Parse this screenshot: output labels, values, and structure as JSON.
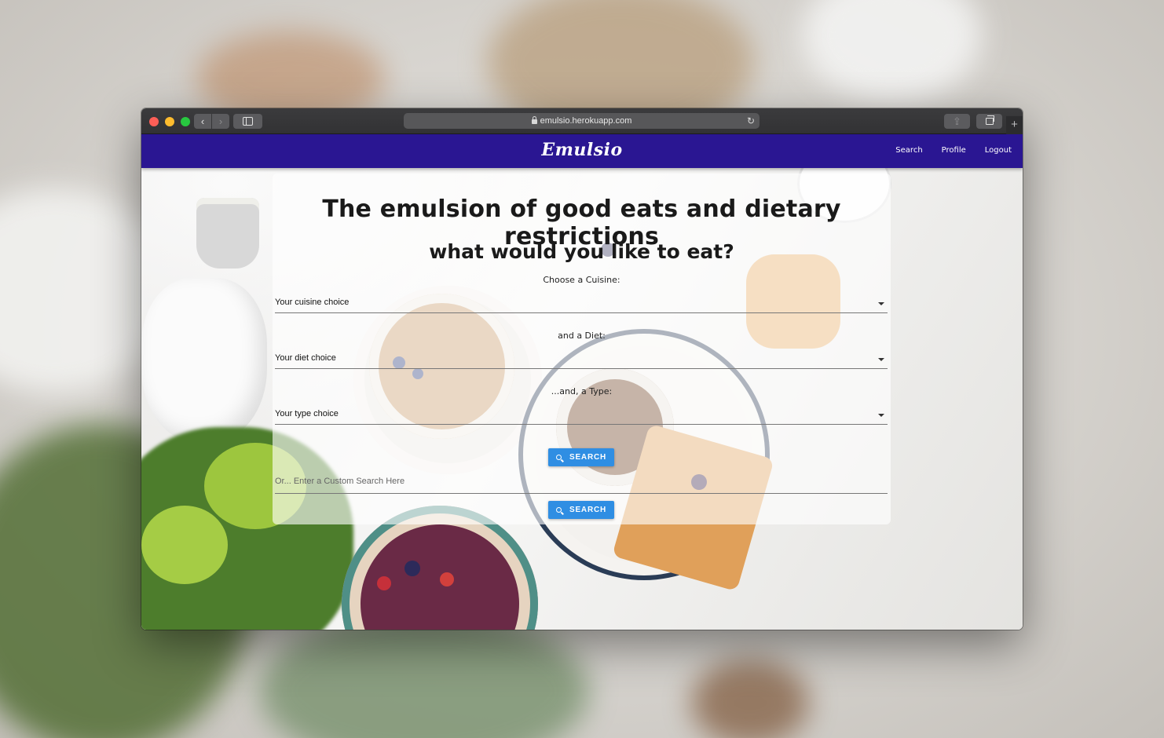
{
  "browser": {
    "url": "emulsio.herokuapp.com",
    "new_tab_symbol": "+",
    "back_symbol": "‹",
    "forward_symbol": "›",
    "reload_symbol": "↻",
    "share_symbol": "⇪"
  },
  "nav": {
    "brand": "Emulsio",
    "links": [
      "Search",
      "Profile",
      "Logout"
    ],
    "bg_color": "#2a1692"
  },
  "hero": {
    "headline": "The emulsion of good eats and dietary restrictions",
    "subheadline": "what would you like to eat?"
  },
  "form": {
    "cuisine_label": "Choose a Cuisine:",
    "cuisine_value": "Your cuisine choice",
    "diet_label": "and a Diet:",
    "diet_value": "Your diet choice",
    "type_label": "...and, a Type:",
    "type_value": "Your type choice",
    "search_label": "SEARCH",
    "custom_placeholder": "Or... Enter a Custom Search Here",
    "custom_search_label": "SEARCH",
    "button_color": "#2f8ee3"
  }
}
